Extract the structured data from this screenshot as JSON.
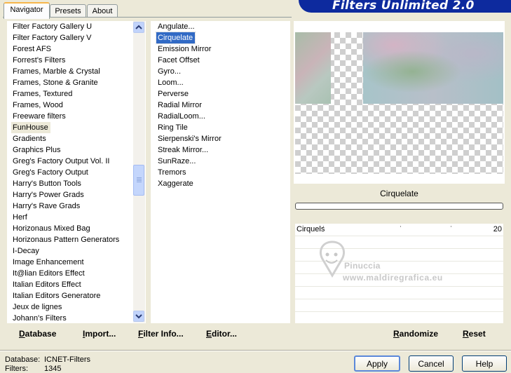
{
  "tabs": [
    "Navigator",
    "Presets",
    "About"
  ],
  "banner_title": "Filters Unlimited 2.0",
  "categories": [
    "Filter Factory Gallery U",
    "Filter Factory Gallery V",
    "Forest AFS",
    "Forrest's Filters",
    "Frames, Marble & Crystal",
    "Frames, Stone & Granite",
    "Frames, Textured",
    "Frames, Wood",
    "Freeware filters",
    "FunHouse",
    "Gradients",
    "Graphics Plus",
    "Greg's Factory Output Vol. II",
    "Greg's Factory Output",
    "Harry's Button Tools",
    "Harry's Power Grads",
    "Harry's Rave Grads",
    "Herf",
    "Horizonaus Mixed Bag",
    "Horizonaus Pattern Generators",
    "I-Decay",
    "Image Enhancement",
    "It@lian Editors Effect",
    "Italian Editors Effect",
    "Italian Editors Generatore",
    "Jeux de lignes",
    "Johann's Filters"
  ],
  "selected_category": "FunHouse",
  "filters": [
    "Angulate...",
    "Cirquelate",
    "Emission Mirror",
    "Facet Offset",
    "Gyro...",
    "Loom...",
    "Perverse",
    "Radial Mirror",
    "RadialLoom...",
    "Ring Tile",
    "Sierpenski's Mirror",
    "Streak Mirror...",
    "SunRaze...",
    "Tremors",
    "Xaggerate"
  ],
  "selected_filter": "Cirquelate",
  "left_buttons": {
    "database": "Database",
    "import": "Import...",
    "filter_info": "Filter Info...",
    "editor": "Editor..."
  },
  "preview_filter_name": "Cirquelate",
  "parameters": [
    {
      "name": "Cirquels",
      "value": "20"
    }
  ],
  "right_buttons": {
    "randomize": "Randomize",
    "reset": "Reset"
  },
  "watermark": {
    "line1": "Pinuccia",
    "line2": "www.maldiregrafica.eu"
  },
  "status": {
    "database_label": "Database:",
    "database_value": "ICNET-Filters",
    "filters_label": "Filters:",
    "filters_value": "1345"
  },
  "dialog_buttons": {
    "apply": "Apply",
    "cancel": "Cancel",
    "help": "Help"
  }
}
